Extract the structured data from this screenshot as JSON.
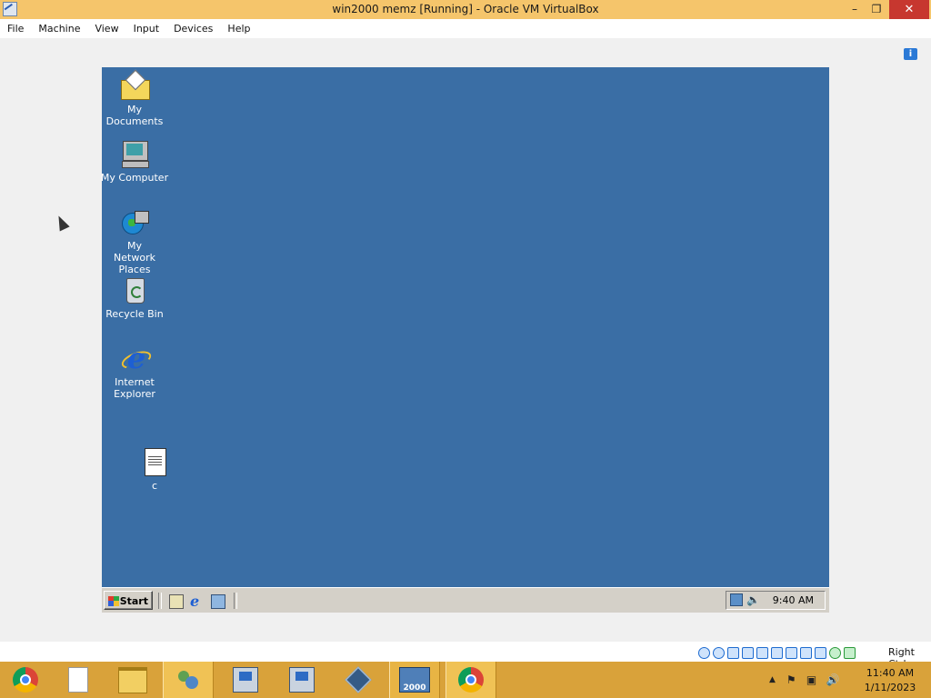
{
  "host": {
    "title": "win2000 memz [Running] - Oracle VM VirtualBox",
    "window_controls": {
      "minimize": "–",
      "maximize": "❐",
      "close": "✕"
    },
    "menu": [
      "File",
      "Machine",
      "View",
      "Input",
      "Devices",
      "Help"
    ],
    "notification_icon": "info-balloon-icon",
    "status_icons": [
      "hard-disk-icon",
      "optical-drive-icon",
      "audio-icon",
      "network-icon",
      "usb-icon",
      "shared-folders-icon",
      "display-icon",
      "video-capture-icon",
      "vm-state-icon",
      "mouse-integration-icon",
      "host-key-icon"
    ],
    "host_key": "Right Ctrl",
    "taskbar": {
      "apps": [
        {
          "name": "chrome-icon",
          "state": "normal"
        },
        {
          "name": "file-icon",
          "state": "normal"
        },
        {
          "name": "file-explorer-icon",
          "state": "normal"
        },
        {
          "name": "users-icon",
          "state": "active"
        },
        {
          "name": "setup-icon",
          "state": "normal"
        },
        {
          "name": "setup-icon",
          "state": "normal"
        },
        {
          "name": "virtualbox-icon",
          "state": "normal"
        },
        {
          "name": "windows-2000-icon",
          "state": "pressed"
        },
        {
          "name": "chrome-icon",
          "state": "active"
        }
      ],
      "tray_icons": [
        "show-hidden-icons",
        "action-center-flag-icon",
        "network-icon",
        "volume-icon"
      ],
      "clock_time": "11:40 AM",
      "clock_date": "1/11/2023"
    }
  },
  "guest": {
    "desktop_bg": "#3a6ea5",
    "icons": [
      {
        "name": "my-documents-icon",
        "label": "My Documents"
      },
      {
        "name": "my-computer-icon",
        "label": "My Computer"
      },
      {
        "name": "my-network-places-icon",
        "label": "My Network Places"
      },
      {
        "name": "recycle-bin-icon",
        "label": "Recycle Bin"
      },
      {
        "name": "internet-explorer-icon",
        "label": "Internet Explorer"
      },
      {
        "name": "text-file-icon",
        "label": "c"
      }
    ],
    "taskbar": {
      "start_label": "Start",
      "quick_launch": [
        "show-desktop-icon",
        "internet-explorer-icon",
        "view-channels-icon"
      ],
      "tray_icons": [
        "network-icon",
        "volume-icon"
      ],
      "clock": "9:40 AM"
    }
  }
}
